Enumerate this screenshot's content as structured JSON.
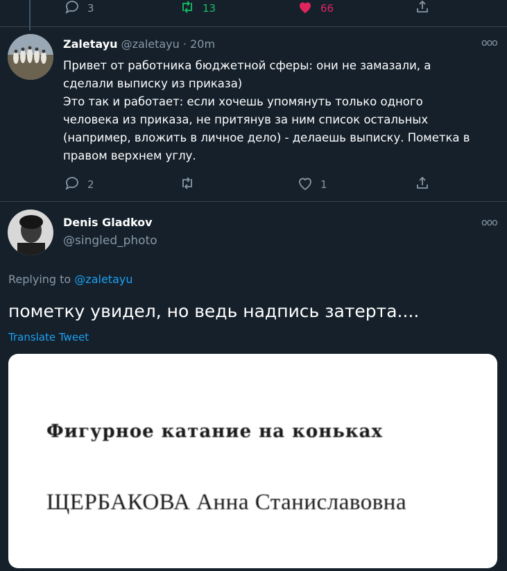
{
  "prev_tweet": {
    "reply_count": "3",
    "retweet_count": "13",
    "like_count": "66",
    "colors": {
      "retweet": "#17bf63",
      "like": "#e0245e"
    }
  },
  "tweet1": {
    "name": "Zaletayu",
    "handle": "@zaletayu",
    "dot": "·",
    "time": "20m",
    "more": "ooo",
    "text": "Привет от работника бюджетной сферы: они не замазали, а\nсделали выписку из приказа)\nЭто так и работает: если хочешь упомянуть только одного\nчеловека из приказа, не притянув за ним список остальных\n(например, вложить в личное дело) - делаешь выписку. Пометка в\nправом верхнем углу.",
    "reply_count": "2",
    "like_count": "1"
  },
  "tweet2": {
    "name": "Denis Gladkov",
    "handle": "@singled_photo",
    "more": "ooo",
    "replying_prefix": "Replying to",
    "replying_to": "@zaletayu",
    "text": "пометку увидел, но ведь надпись затерта....",
    "translate": "Translate Tweet",
    "image_line1": "Фигурное катание на коньках",
    "image_line2": "ЩЕРБАКОВА Анна Станиславовна"
  },
  "icons": [
    "reply-icon",
    "retweet-icon",
    "like-icon",
    "share-icon",
    "more-icon"
  ]
}
